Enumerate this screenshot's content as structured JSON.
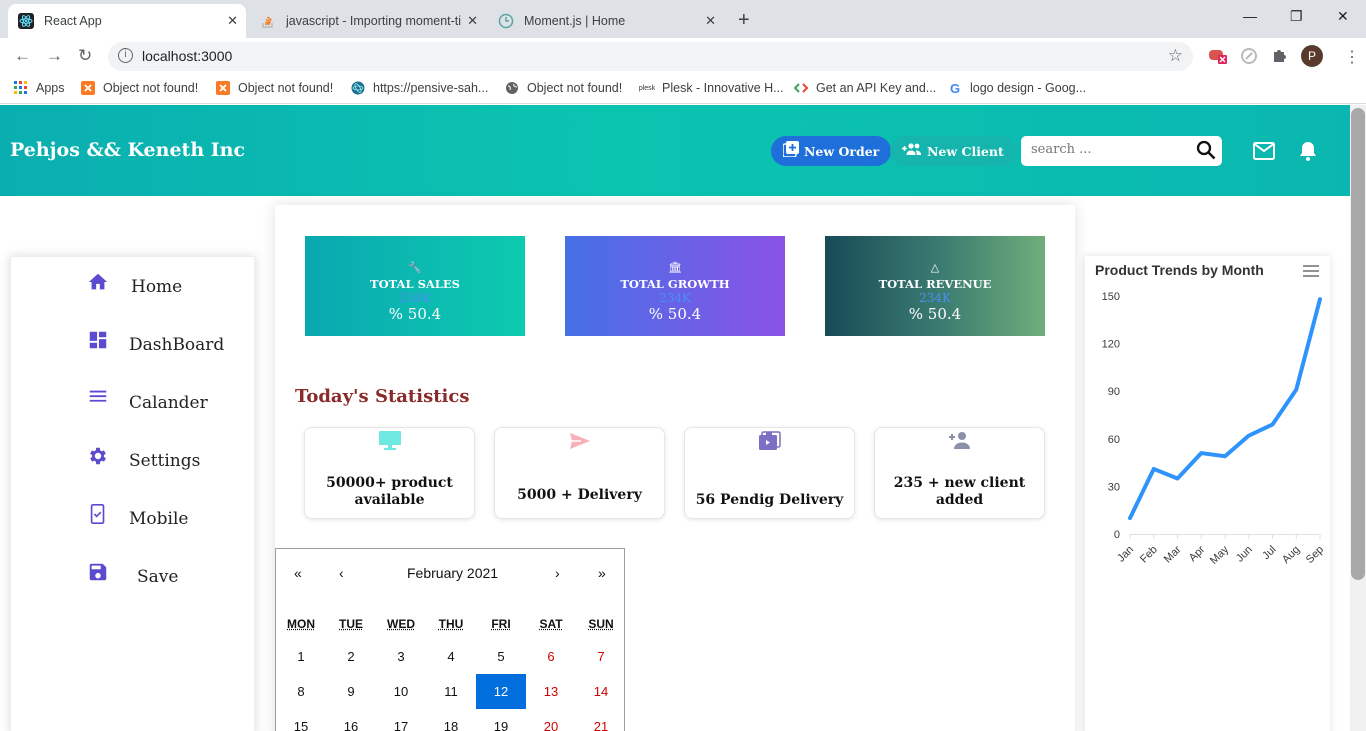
{
  "browser": {
    "tabs": [
      {
        "title": "React App",
        "active": true
      },
      {
        "title": "javascript - Importing moment-ti",
        "active": false
      },
      {
        "title": "Moment.js | Home",
        "active": false
      }
    ],
    "url": "localhost:3000",
    "profile_initial": "P",
    "bookmarks": [
      {
        "label": "Apps",
        "icon": "apps-grid-icon"
      },
      {
        "label": "Object not found!",
        "icon": "xampp-icon"
      },
      {
        "label": "Object not found!",
        "icon": "xampp-icon"
      },
      {
        "label": "https://pensive-sah...",
        "icon": "react-icon"
      },
      {
        "label": "Object not found!",
        "icon": "globe-icon"
      },
      {
        "label": "Plesk - Innovative H...",
        "icon": "plesk-icon"
      },
      {
        "label": "Get an API Key and...",
        "icon": "code-icon"
      },
      {
        "label": "logo design - Goog...",
        "icon": "google-icon"
      }
    ]
  },
  "header": {
    "brand": "Pehjos && Keneth Inc",
    "new_order": "New Order",
    "new_client": "New Client",
    "search_placeholder": "search ..."
  },
  "sidebar": {
    "items": [
      {
        "label": "Home",
        "icon": "home-icon"
      },
      {
        "label": "DashBoard",
        "icon": "dashboard-icon"
      },
      {
        "label": "Calander",
        "icon": "list-icon"
      },
      {
        "label": "Settings",
        "icon": "gear-icon"
      },
      {
        "label": "Mobile",
        "icon": "mobile-check-icon"
      },
      {
        "label": "Save",
        "icon": "save-icon"
      }
    ]
  },
  "cards": [
    {
      "title": "TOTAL SALES",
      "value": "234K",
      "percent": "% 50.4",
      "icon": "wrench-icon"
    },
    {
      "title": "TOTAL GROWTH",
      "value": "234K",
      "percent": "% 50.4",
      "icon": "bank-icon"
    },
    {
      "title": "TOTAL REVENUE",
      "value": "234K",
      "percent": "% 50.4",
      "icon": "triangle-icon"
    }
  ],
  "statistics": {
    "title": "Today's Statistics",
    "items": [
      {
        "line1": "50000+ product",
        "line2": "available",
        "icon": "monitor-icon"
      },
      {
        "line1": "5000 + Delivery",
        "line2": "",
        "icon": "send-icon"
      },
      {
        "line1": "56 Pendig Delivery",
        "line2": "",
        "icon": "briefcase-icon"
      },
      {
        "line1": "235 + new client",
        "line2": "added",
        "icon": "add-person-icon"
      }
    ]
  },
  "calendar": {
    "month_label": "February 2021",
    "nav": {
      "prev2": "«",
      "prev": "‹",
      "next": "›",
      "next2": "»"
    },
    "weekdays": [
      "MON",
      "TUE",
      "WED",
      "THU",
      "FRI",
      "SAT",
      "SUN"
    ],
    "weeks": [
      [
        "1",
        "2",
        "3",
        "4",
        "5",
        "6",
        "7"
      ],
      [
        "8",
        "9",
        "10",
        "11",
        "12",
        "13",
        "14"
      ],
      [
        "15",
        "16",
        "17",
        "18",
        "19",
        "20",
        "21"
      ]
    ],
    "selected": "12"
  },
  "chart_data": {
    "type": "line",
    "title": "Product Trends by Month",
    "categories": [
      "Jan",
      "Feb",
      "Mar",
      "Apr",
      "May",
      "Jun",
      "Jul",
      "Aug",
      "Sep"
    ],
    "series": [
      {
        "values": [
          10,
          41,
          35,
          51,
          49,
          62,
          69,
          91,
          148
        ]
      }
    ],
    "ylim": [
      0,
      150
    ],
    "yticks": [
      0,
      30,
      60,
      90,
      120,
      150
    ],
    "color": "#2e93fa",
    "grid": false
  }
}
